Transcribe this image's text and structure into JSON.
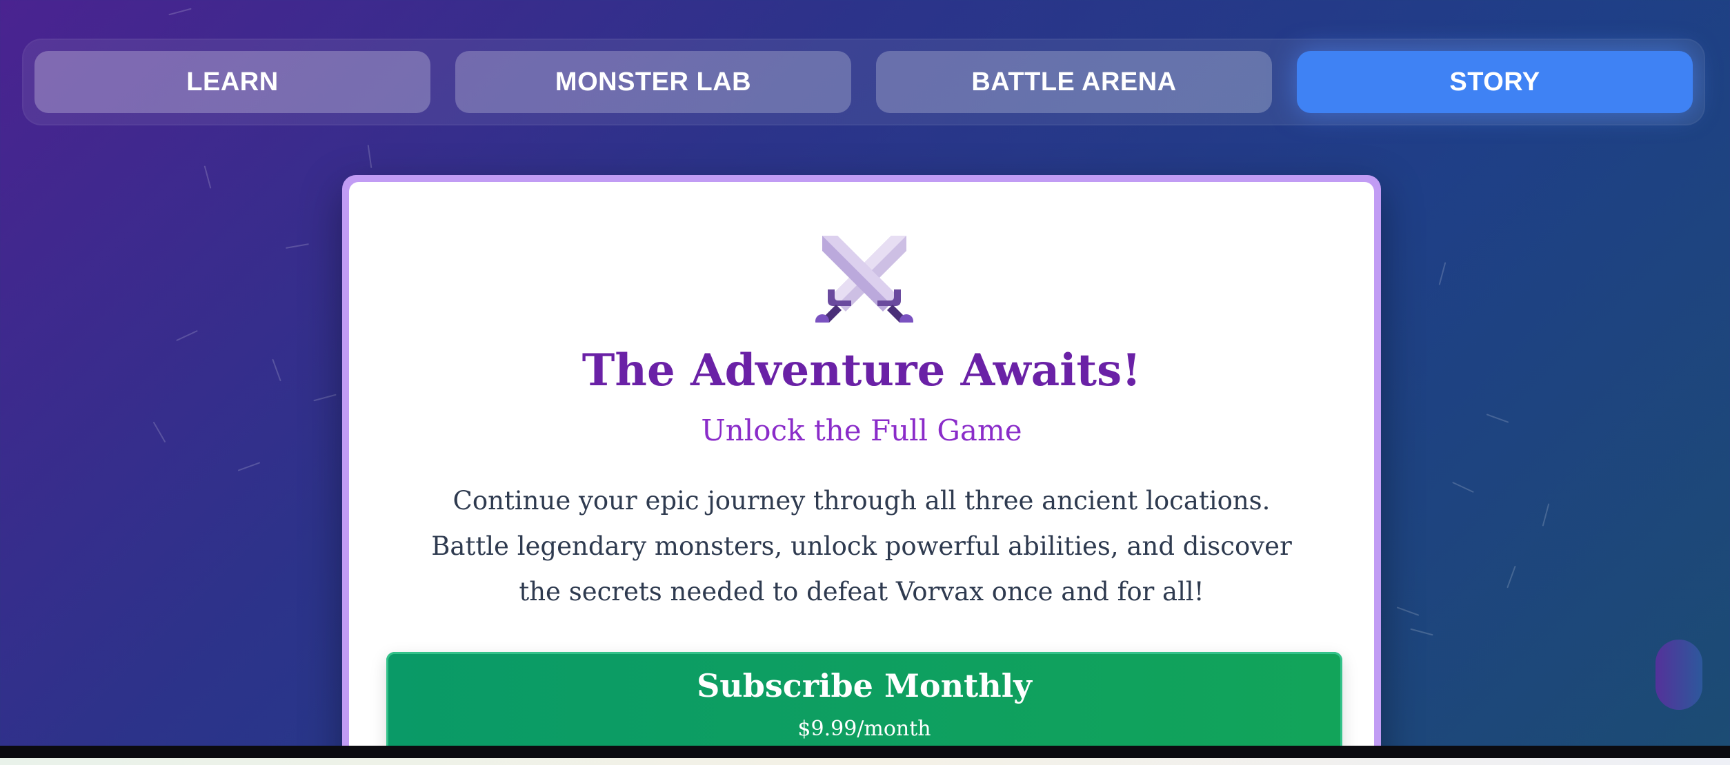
{
  "nav": {
    "tabs": [
      {
        "label": "LEARN",
        "active": false
      },
      {
        "label": "MONSTER LAB",
        "active": false
      },
      {
        "label": "BATTLE ARENA",
        "active": false
      },
      {
        "label": "STORY",
        "active": true
      }
    ],
    "active_color": "#3f82f4"
  },
  "card": {
    "icon": "crossed-swords-icon",
    "title": "The Adventure Awaits!",
    "subtitle": "Unlock the Full Game",
    "description": "Continue your epic journey through all three ancient locations. Battle legendary monsters, unlock powerful abilities, and discover the secrets needed to defeat Vorvax once and for all!",
    "border_color": "#c19cf4"
  },
  "subscribe": {
    "label": "Subscribe Monthly",
    "price": "$9.99/month",
    "color": "#0a9a67"
  }
}
